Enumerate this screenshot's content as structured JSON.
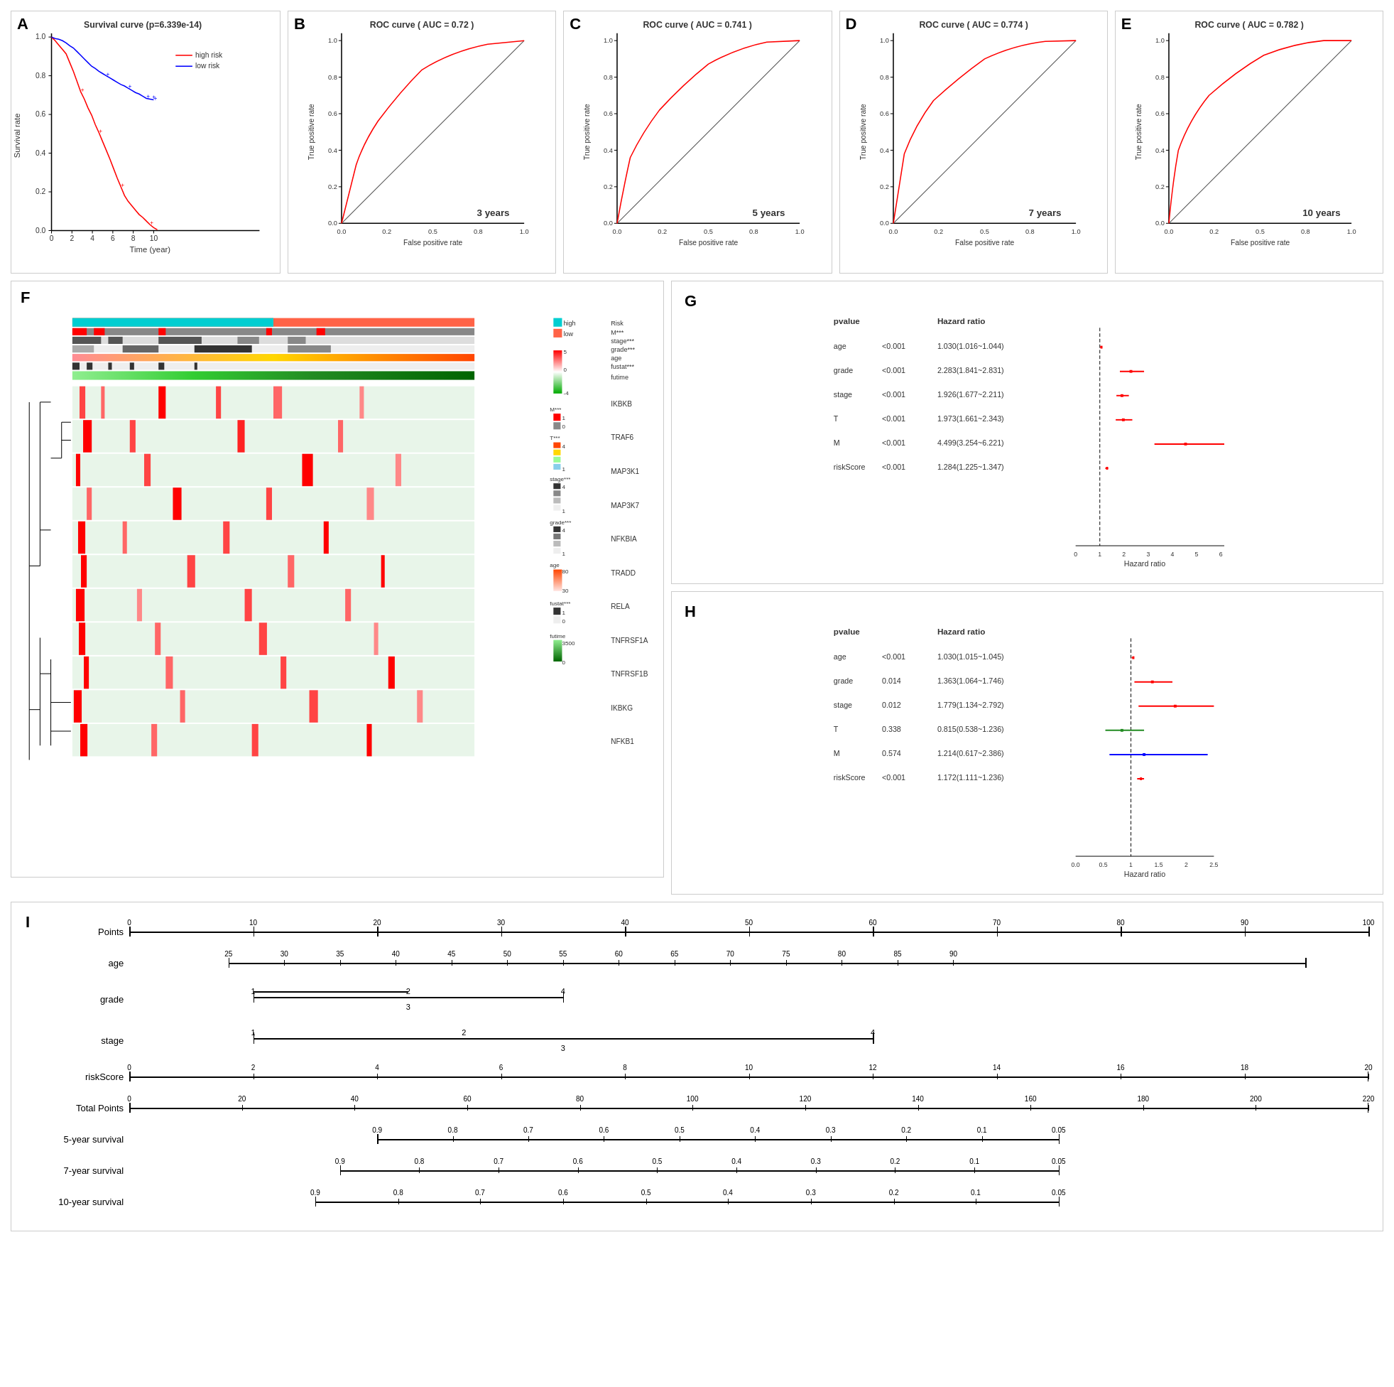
{
  "panels": {
    "A": {
      "label": "A",
      "title": "Survival curve (p=6.339e-14)",
      "x_axis": "Time (year)",
      "y_axis": "Survival rate",
      "legend": [
        "high risk",
        "low risk"
      ],
      "colors": {
        "high": "#FF0000",
        "low": "#0000FF"
      }
    },
    "B": {
      "label": "B",
      "title": "ROC curve ( AUC = 0.72 )",
      "year_label": "3 years",
      "x_axis": "False positive rate",
      "y_axis": "True positive rate"
    },
    "C": {
      "label": "C",
      "title": "ROC curve ( AUC = 0.741 )",
      "year_label": "5 years",
      "x_axis": "False positive rate",
      "y_axis": "True positive rate"
    },
    "D": {
      "label": "D",
      "title": "ROC curve ( AUC = 0.774 )",
      "year_label": "7 years",
      "x_axis": "False positive rate",
      "y_axis": "True positive rate"
    },
    "E": {
      "label": "E",
      "title": "ROC curve ( AUC = 0.782 )",
      "year_label": "10 years",
      "x_axis": "False positive rate",
      "y_axis": "True positive rate"
    },
    "F": {
      "label": "F",
      "genes": [
        "IKBKB",
        "TRAF6",
        "MAP3K1",
        "MAP3K7",
        "NFKBIA",
        "TRADD",
        "RELA",
        "TNFRSF1A",
        "TNFRSF1B",
        "IKBKG",
        "NFKB1"
      ],
      "tracks": [
        "Risk",
        "M***",
        "stage***",
        "grade***",
        "age",
        "fustat***",
        "futime"
      ],
      "legend_risk": {
        "high": "#00BFFF",
        "low": "#FF6347"
      },
      "legend_M": "M***",
      "legend_stage": "stage***",
      "legend_grade": "grade***",
      "legend_age": "age",
      "legend_fustat": "fustat***",
      "legend_futime": "futime"
    },
    "G": {
      "label": "G",
      "col1": "pvalue",
      "col2": "Hazard ratio",
      "x_label": "Hazard ratio",
      "rows": [
        {
          "var": "age",
          "pvalue": "<0.001",
          "hr": "1.030(1.016~1.044)",
          "point": 1.03,
          "ci_low": 1.016,
          "ci_high": 1.044,
          "color": "red"
        },
        {
          "var": "grade",
          "pvalue": "<0.001",
          "hr": "2.283(1.841~2.831)",
          "point": 2.283,
          "ci_low": 1.841,
          "ci_high": 2.831,
          "color": "red"
        },
        {
          "var": "stage",
          "pvalue": "<0.001",
          "hr": "1.926(1.677~2.211)",
          "point": 1.926,
          "ci_low": 1.677,
          "ci_high": 2.211,
          "color": "red"
        },
        {
          "var": "T",
          "pvalue": "<0.001",
          "hr": "1.973(1.661~2.343)",
          "point": 1.973,
          "ci_low": 1.661,
          "ci_high": 2.343,
          "color": "red"
        },
        {
          "var": "M",
          "pvalue": "<0.001",
          "hr": "4.499(3.254~6.221)",
          "point": 4.499,
          "ci_low": 3.254,
          "ci_high": 6.221,
          "color": "red"
        },
        {
          "var": "riskScore",
          "pvalue": "<0.001",
          "hr": "1.284(1.225~1.347)",
          "point": 1.284,
          "ci_low": 1.225,
          "ci_high": 1.347,
          "color": "red"
        }
      ]
    },
    "H": {
      "label": "H",
      "col1": "pvalue",
      "col2": "Hazard ratio",
      "x_label": "Hazard ratio",
      "rows": [
        {
          "var": "age",
          "pvalue": "<0.001",
          "hr": "1.030(1.015~1.045)",
          "point": 1.03,
          "ci_low": 1.015,
          "ci_high": 1.045,
          "color": "red"
        },
        {
          "var": "grade",
          "pvalue": "0.014",
          "hr": "1.363(1.064~1.746)",
          "point": 1.363,
          "ci_low": 1.064,
          "ci_high": 1.746,
          "color": "red"
        },
        {
          "var": "stage",
          "pvalue": "0.012",
          "hr": "1.779(1.134~2.792)",
          "point": 1.779,
          "ci_low": 1.134,
          "ci_high": 2.792,
          "color": "red"
        },
        {
          "var": "T",
          "pvalue": "0.338",
          "hr": "0.815(0.538~1.236)",
          "point": 0.815,
          "ci_low": 0.538,
          "ci_high": 1.236,
          "color": "green"
        },
        {
          "var": "M",
          "pvalue": "0.574",
          "hr": "1.214(0.617~2.386)",
          "point": 1.214,
          "ci_low": 0.617,
          "ci_high": 2.386,
          "color": "blue"
        },
        {
          "var": "riskScore",
          "pvalue": "<0.001",
          "hr": "1.172(1.111~1.236)",
          "point": 1.172,
          "ci_low": 1.111,
          "ci_high": 1.236,
          "color": "red"
        }
      ]
    },
    "I": {
      "label": "I",
      "rows": [
        {
          "name": "Points",
          "ticks": [
            0,
            10,
            20,
            30,
            40,
            50,
            60,
            70,
            80,
            90,
            100
          ],
          "type": "scale"
        },
        {
          "name": "age",
          "ticks": [
            25,
            30,
            35,
            40,
            45,
            50,
            55,
            60,
            65,
            70,
            75,
            80,
            85,
            90
          ],
          "type": "scale"
        },
        {
          "name": "grade",
          "values": [
            "1",
            "2",
            "3",
            "4"
          ],
          "type": "categorical"
        },
        {
          "name": "stage",
          "values": [
            "1",
            "2",
            "3",
            "4"
          ],
          "type": "categorical"
        },
        {
          "name": "riskScore",
          "ticks": [
            0,
            2,
            4,
            6,
            8,
            10,
            12,
            14,
            16,
            18,
            20
          ],
          "type": "scale"
        },
        {
          "name": "Total Points",
          "ticks": [
            0,
            20,
            40,
            60,
            80,
            100,
            120,
            140,
            160,
            180,
            200,
            220
          ],
          "type": "scale"
        },
        {
          "name": "5-year survival",
          "values": [
            "0.9",
            "0.8",
            "0.7",
            "0.6",
            "0.5",
            "0.4",
            "0.3",
            "0.2",
            "0.1",
            "0.05"
          ],
          "type": "survival"
        },
        {
          "name": "7-year survival",
          "values": [
            "0.9",
            "0.8",
            "0.7",
            "0.6",
            "0.5",
            "0.4",
            "0.3",
            "0.2",
            "0.1",
            "0.05"
          ],
          "type": "survival"
        },
        {
          "name": "10-year survival",
          "values": [
            "0.9",
            "0.8",
            "0.7",
            "0.6",
            "0.5",
            "0.4",
            "0.3",
            "0.2",
            "0.1",
            "0.05"
          ],
          "type": "survival"
        }
      ]
    }
  }
}
